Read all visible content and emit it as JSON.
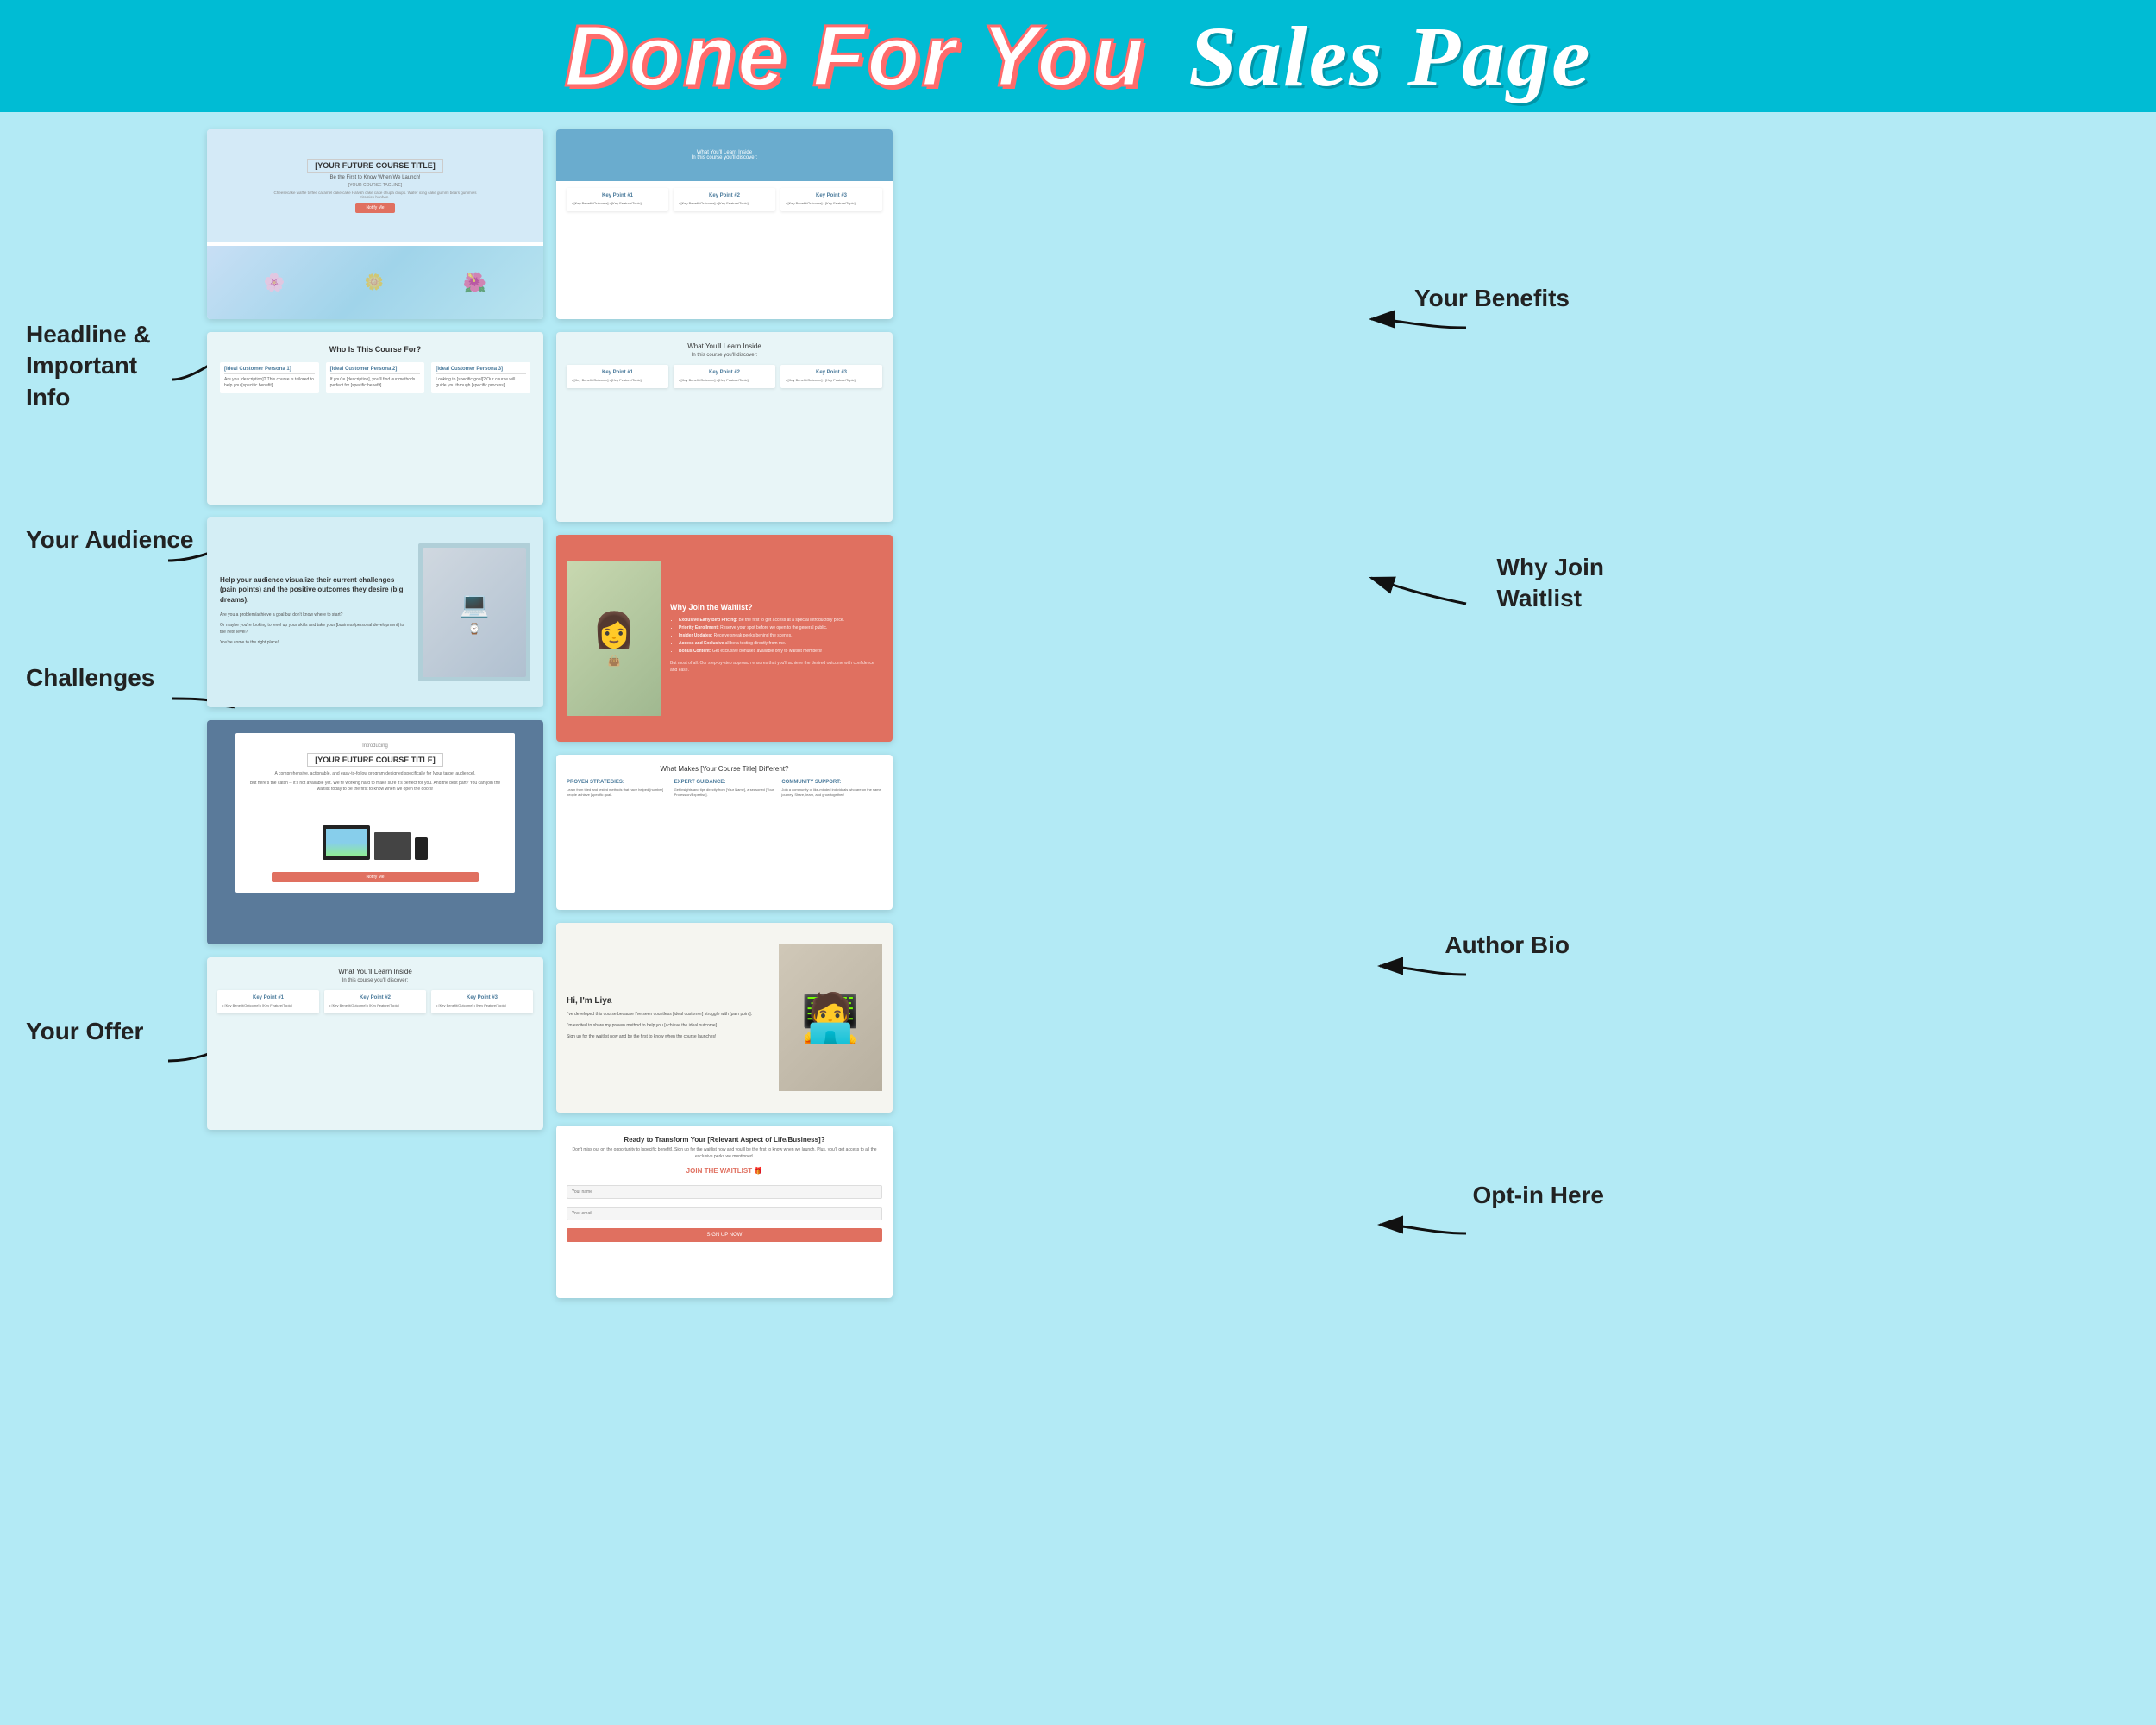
{
  "header": {
    "title_part1": "Done For You",
    "title_part2": "Sales Page"
  },
  "labels": {
    "headline": "Headline &\nImportant\nInfo",
    "audience": "Your Audience",
    "challenges": "Challenges",
    "your_offer": "Your Offer",
    "benefits": "Your Benefits",
    "why_join": "Why Join\nWaitlist",
    "author_bio": "Author Bio",
    "optin": "Opt-in Here"
  },
  "sections": {
    "hero": {
      "course_title": "[YOUR FUTURE COURSE TITLE]",
      "tagline": "Be the First to Know When We Launch!",
      "course_tagline": "[YOUR COURSE TAGLINE]",
      "description": "Cheesecake waffle toffee caramel cake cake Halvah cake cake chupa chups. Wafer icing cake gummi bears gummies tiramisu bonbon.",
      "button": "Notify Me"
    },
    "who_for": {
      "title": "Who Is This Course For?",
      "persona1_title": "[Ideal Customer Persona 1]",
      "persona1_text": "Are you [description]? This course is tailored to help you [specific benefit]",
      "persona2_title": "[Ideal Customer Persona 2]",
      "persona2_text": "If you're [description], you'll find our methods perfect for [specific benefit]",
      "persona3_title": "[Ideal Customer Persona 3]",
      "persona3_text": "Looking to [specific goal]? Our course will guide you through [specific process]"
    },
    "challenges": {
      "heading": "Help your audience visualize their current challenges (pain points) and the positive outcomes they desire (big dreams).",
      "para1": "Are you a problem/achieve a goal but don't know where to start?",
      "para2": "Or maybe you're looking to level up your skills and take your [business/personal development] to the next level?",
      "para3": "You've come to the right place!"
    },
    "offer": {
      "introducing": "Introducing",
      "course_title": "[YOUR FUTURE COURSE TITLE]",
      "description": "A comprehensive, actionable, and easy-to-follow program designed specifically for [your target audience].",
      "note": "But here's the catch -- it's not available yet. We're working hard to make sure it's perfect for you. And the best part? You can join the waitlist today to be the first to know when we open the doors!",
      "button": "Notify Me"
    },
    "benefits": {
      "title": "What You'll Learn Inside",
      "subtitle": "In this course you'll discover:",
      "point1_title": "Key Point #1",
      "point1_items": "• [Key Benefit/Outcome]\n• [Key Feature/Topic]",
      "point2_title": "Key Point #2",
      "point2_items": "• [Key Benefit/Outcome]\n• [Key Feature/Topic]",
      "point3_title": "Key Point #3",
      "point3_items": "• [Key Benefit/Outcome]\n• [Key Feature/Topic]"
    },
    "right_benefits": {
      "bar_text1": "What You'll Learn Inside",
      "bar_text2": "In this course you'll discover:"
    },
    "waitlist": {
      "title": "Why Join the Waitlist?",
      "items": [
        "Exclusive Early Bird Pricing: Be the first to get access at a special introductory price.",
        "Priority Enrollment: Reserve your spot before we open to the general public.",
        "Insider Updates: Receive sneak peeks behind the scenes.",
        "Access and Exclusive all beta testing directly from me.",
        "Bonus Content: Get exclusive bonuses available only to waitlist members!"
      ],
      "footer": "But most of all: Our step-by-step approach ensures that you'll achieve the desired outcome with confidence and ease."
    },
    "different": {
      "title": "What Makes [Your Course Title] Different?",
      "col1_title": "PROVEN STRATEGIES:",
      "col1_text": "Learn from tried and tested methods that have helped [number] people achieve [specific goal].",
      "col2_title": "EXPERT GUIDANCE:",
      "col2_text": "Get insights and tips directly from [Your Name], a seasoned [Your Profession/Expertise].",
      "col3_title": "COMMUNITY SUPPORT:",
      "col3_text": "Join a community of like-minded individuals who are on the same journey. Share, learn, and grow together!"
    },
    "author": {
      "title": "Hi, I'm Liya",
      "para1": "I've developed this course because I've seen countless [ideal customer] struggle with [pain point].",
      "para2": "I'm excited to share my proven method to help you [achieve the ideal outcome].",
      "para3": "Sign up for the waitlist now and be the first to know when the course launches!"
    },
    "optin": {
      "title": "Ready to Transform Your [Relevant Aspect of Life/Business]?",
      "description": "Don't miss out on the opportunity to [specific benefit]. Sign up for the waitlist now and you'll be the first to know when we launch. Plus, you'll get access to all the exclusive perks we mentioned.",
      "cta": "JOIN THE WAITLIST 🎁",
      "field1_placeholder": "Your name",
      "field2_placeholder": "Your email",
      "button": "SIGN UP NOW"
    }
  }
}
